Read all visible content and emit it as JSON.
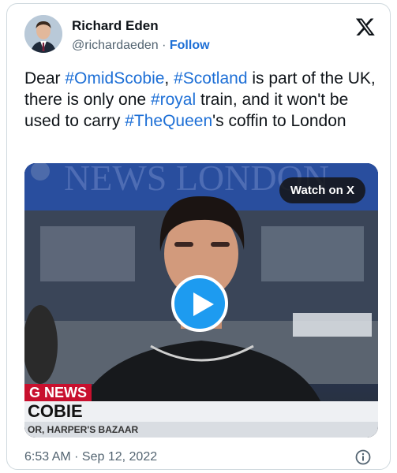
{
  "author": {
    "name": "Richard Eden",
    "handle": "@richardaeden",
    "separator": "·",
    "follow_label": "Follow"
  },
  "tweet": {
    "segments": [
      {
        "text": "Dear ",
        "tag": false
      },
      {
        "text": "#OmidScobie",
        "tag": true
      },
      {
        "text": ", ",
        "tag": false
      },
      {
        "text": "#Scotland",
        "tag": true
      },
      {
        "text": " is part of the UK, there is only one ",
        "tag": false
      },
      {
        "text": "#royal",
        "tag": true
      },
      {
        "text": " train, and it won't be used to carry ",
        "tag": false
      },
      {
        "text": "#TheQueen",
        "tag": true
      },
      {
        "text": "'s coffin to London",
        "tag": false
      }
    ]
  },
  "media": {
    "watch_label": "Watch on X",
    "backdrop_text": "NEWS LONDON",
    "chyron_top": "G NEWS",
    "chyron_name": "COBIE",
    "chyron_sub": "OR, HARPER'S BAZAAR"
  },
  "timestamp": "6:53 AM · Sep 12, 2022",
  "colors": {
    "link": "#1d6fd6",
    "play": "#1d9bf0",
    "chyron": "#c8102e"
  },
  "icons": {
    "brand": "x-logo-icon",
    "info": "info-icon",
    "play": "play-icon"
  }
}
